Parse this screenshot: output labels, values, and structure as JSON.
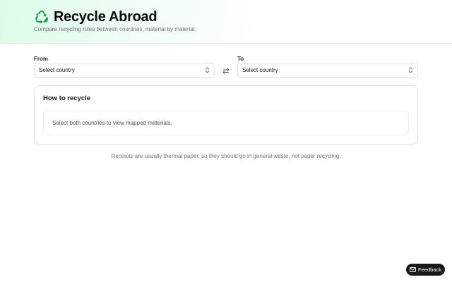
{
  "app": {
    "title": "Recycle Abroad",
    "subtitle": "Compare recycling rules between countries, material by material."
  },
  "selectors": {
    "from_label": "From",
    "from_value": "Select country",
    "to_label": "To",
    "to_value": "Select country"
  },
  "card": {
    "title": "How to recycle",
    "empty_message": "Select both countries to view mapped materials."
  },
  "tip": "Receipts are usually thermal paper, so they should go in general waste, not paper recycling.",
  "feedback": {
    "label": "Feedback"
  },
  "icons": {
    "logo": "recycle-icon",
    "select_chevron": "chevron-up-down-icon",
    "swap": "swap-arrows-icon",
    "feedback": "mail-icon"
  },
  "colors": {
    "recycle_green": "#16a34a",
    "header_tint": "#dcfce7",
    "feedback_bg": "#18181b"
  }
}
